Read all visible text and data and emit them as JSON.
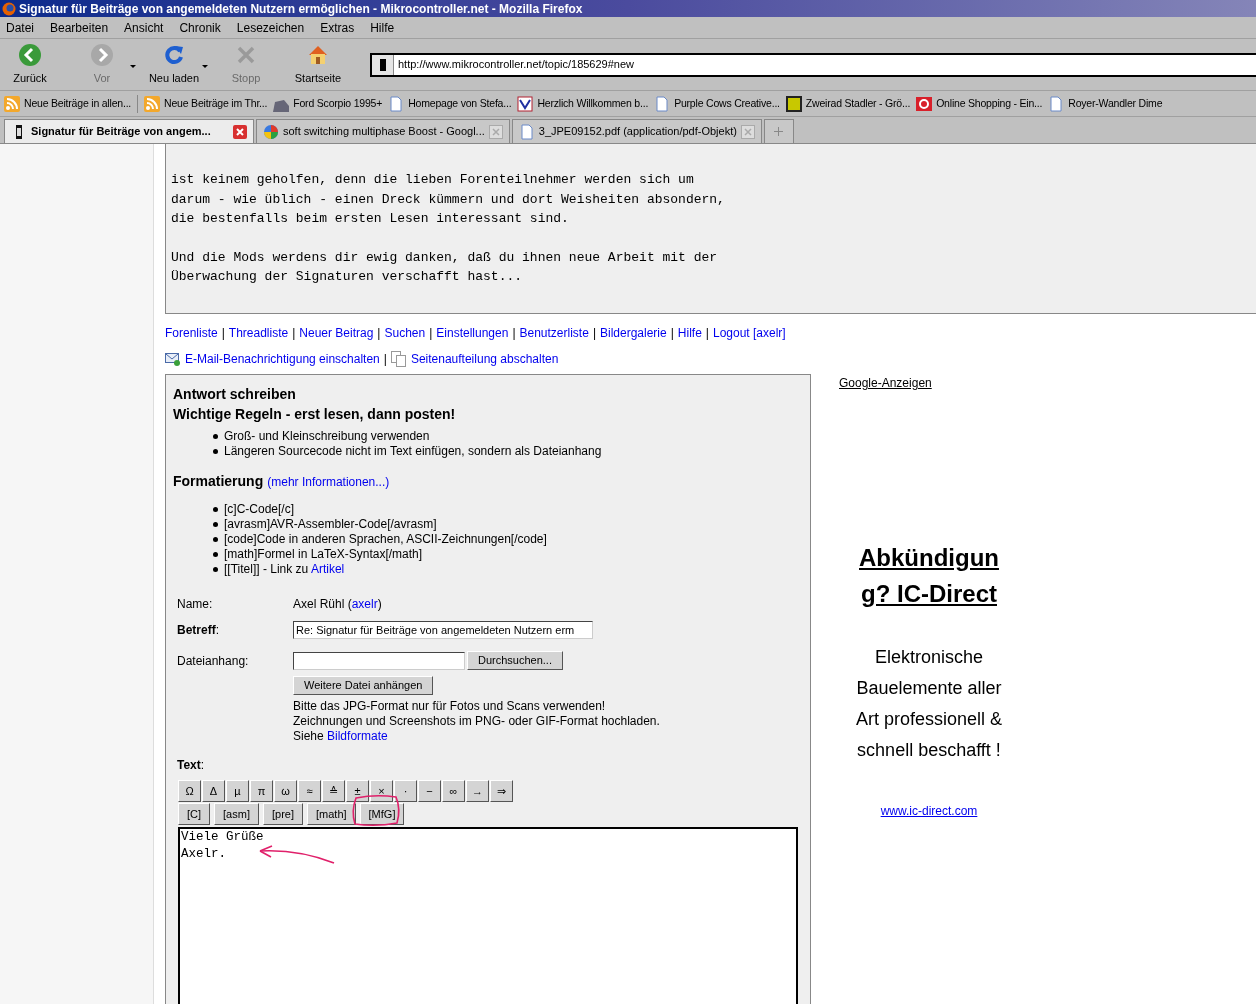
{
  "window": {
    "title": "Signatur für Beiträge von angemeldeten Nutzern ermöglichen - Mikrocontroller.net - Mozilla Firefox"
  },
  "menu": [
    "Datei",
    "Bearbeiten",
    "Ansicht",
    "Chronik",
    "Lesezeichen",
    "Extras",
    "Hilfe"
  ],
  "nav_buttons": [
    {
      "label": "Zurück",
      "kind": "back",
      "disabled": false,
      "dropdown": false
    },
    {
      "label": "Vor",
      "kind": "forward",
      "disabled": true,
      "dropdown": true
    },
    {
      "label": "Neu laden",
      "kind": "reload",
      "disabled": false,
      "dropdown": true
    },
    {
      "label": "Stopp",
      "kind": "stop",
      "disabled": true,
      "dropdown": false
    },
    {
      "label": "Startseite",
      "kind": "home",
      "disabled": false,
      "dropdown": false
    }
  ],
  "address": {
    "value": "http://www.mikrocontroller.net/topic/185629#new"
  },
  "bookmarks": [
    {
      "label": "Neue Beiträge in allen...",
      "kind": "feed"
    },
    {
      "label": "Neue Beiträge im Thr...",
      "kind": "feed"
    },
    {
      "label": "Ford Scorpio 1995+",
      "kind": "car"
    },
    {
      "label": "Homepage von Stefa...",
      "kind": "page"
    },
    {
      "label": "Herzlich Willkommen b...",
      "kind": "logo"
    },
    {
      "label": "Purple Cows Creative...",
      "kind": "page"
    },
    {
      "label": "Zweirad Stadler - Grö...",
      "kind": "square"
    },
    {
      "label": "Online Shopping - Ein...",
      "kind": "q"
    },
    {
      "label": "Royer-Wandler Dime",
      "kind": "page"
    }
  ],
  "tabs": [
    {
      "label": "Signatur für Beiträge von angem...",
      "selected": true,
      "kind": "site"
    },
    {
      "label": "soft switching multiphase Boost - Googl...",
      "selected": false,
      "kind": "google"
    },
    {
      "label": "3_JPE09152.pdf (application/pdf-Objekt)",
      "selected": false,
      "kind": "page"
    }
  ],
  "quote": {
    "paragraphs": [
      [
        "ist keinem geholfen, denn die lieben Forenteilnehmer werden sich um",
        "darum - wie üblich - einen Dreck kümmern und dort Weisheiten absondern,",
        "die bestenfalls beim ersten Lesen interessant sind."
      ],
      [
        "Und die Mods werdens dir ewig danken, daß du ihnen neue Arbeit mit der",
        "Überwachung der Signaturen verschafft hast..."
      ]
    ]
  },
  "separator": "|",
  "nav_links": [
    "Forenliste",
    "Threadliste",
    "Neuer Beitrag",
    "Suchen",
    "Einstellungen",
    "Benutzerliste",
    "Bildergalerie",
    "Hilfe",
    "Logout [axelr]"
  ],
  "option_links": [
    {
      "label": "E-Mail-Benachrichtigung einschalten",
      "kind": "mail"
    },
    {
      "label": "Seitenaufteilung abschalten",
      "kind": "pages"
    }
  ],
  "form": {
    "title": "Antwort schreiben",
    "rules_title": "Wichtige Regeln - erst lesen, dann posten!",
    "rules": [
      "Groß- und Kleinschreibung verwenden",
      "Längeren Sourcecode nicht im Text einfügen, sondern als Dateianhang"
    ],
    "format_title": "Formatierung",
    "format_link": "(mehr Informationen...)",
    "format_items": [
      {
        "text": "[c]C-Code[/c]"
      },
      {
        "text": "[avrasm]AVR-Assembler-Code[/avrasm]"
      },
      {
        "text": "[code]Code in anderen Sprachen, ASCII-Zeichnungen[/code]"
      },
      {
        "text": "[math]Formel in LaTeX-Syntax[/math]"
      },
      {
        "text": "[[Titel]] - Link zu ",
        "link": "Artikel"
      }
    ],
    "name_label": "Name:",
    "name_before": "Axel Rühl (",
    "name_link": "axelr",
    "name_after": ")",
    "subject_label": "**Betreff**:",
    "subject_value": "Re: Signatur für Beiträge von angemeldeten Nutzern erm",
    "attachment_label": "Dateianhang:",
    "browse_button": "Durchsuchen...",
    "more_button": "Weitere Datei anhängen",
    "hint_lines": [
      "Bitte das JPG-Format nur für Fotos und Scans verwenden!",
      "Zeichnungen und Screenshots im PNG- oder GIF-Format hochladen.",
      "Siehe "
    ],
    "hint_link": "Bildformate",
    "text_label": "**Text**:",
    "symbols": [
      "Ω",
      "Δ",
      "µ",
      "π",
      "ω",
      "≈",
      "≙",
      "±",
      "×",
      "·",
      "−",
      "∞",
      "→",
      "⇒"
    ],
    "tags": [
      "[C]",
      "[asm]",
      "[pre]",
      "[math]",
      "[MfG]"
    ],
    "text_value": "Viele Grüße\nAxelr."
  },
  "ad": {
    "label": "Google-Anzeigen",
    "headline": "Abkündigung? IC-Direct",
    "body": "Elektronische Bauelemente aller Art professionell & schnell beschafft !",
    "url": "www.ic-direct.com"
  }
}
